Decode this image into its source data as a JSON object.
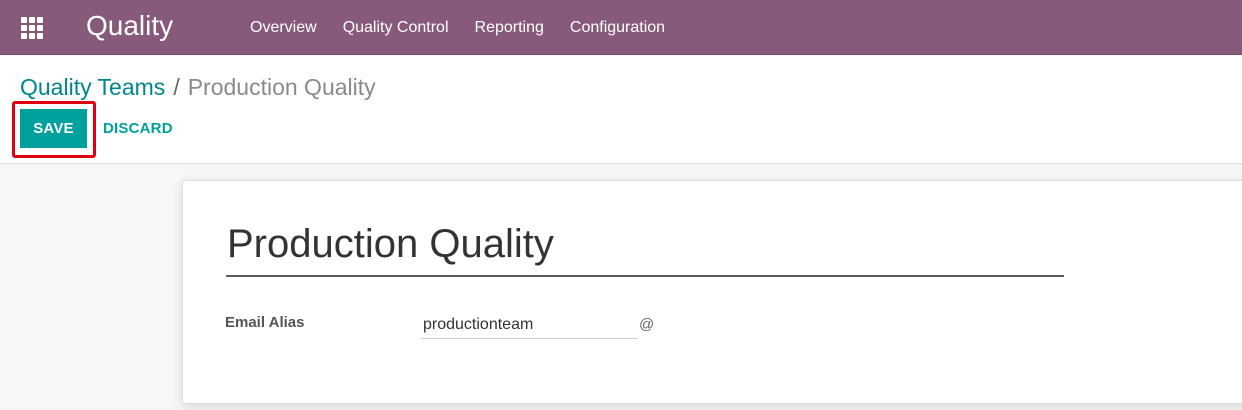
{
  "navbar": {
    "app_title": "Quality",
    "menu": [
      {
        "label": "Overview"
      },
      {
        "label": "Quality Control"
      },
      {
        "label": "Reporting"
      },
      {
        "label": "Configuration"
      }
    ]
  },
  "breadcrumb": {
    "parent": "Quality Teams",
    "separator": "/",
    "current": "Production Quality"
  },
  "actions": {
    "save_label": "SAVE",
    "discard_label": "DISCARD"
  },
  "form": {
    "name_value": "Production Quality",
    "email_alias_label": "Email Alias",
    "email_alias_value": "productionteam",
    "email_alias_suffix": "@"
  },
  "colors": {
    "navbar_bg": "#875a7b",
    "primary": "#00a09d",
    "link": "#00868b",
    "highlight": "#e00012"
  },
  "icons": {
    "apps": "apps-grid-icon"
  }
}
